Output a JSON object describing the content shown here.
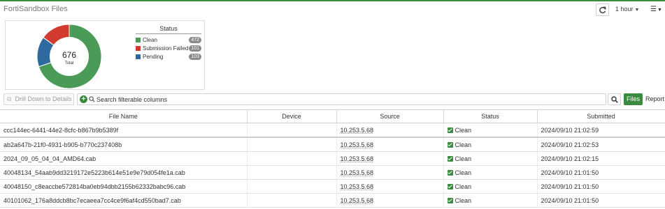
{
  "header": {
    "title": "FortiSandbox Files",
    "time_range": "1 hour",
    "refresh_icon": "refresh-icon",
    "menu_icon": "hamburger-menu-icon"
  },
  "chart_data": {
    "type": "pie",
    "center_value": "676",
    "center_label": "Total",
    "legend_title": "Status",
    "categories": [
      "Clean",
      "Submission Failed",
      "Pending"
    ],
    "values": [
      472,
      101,
      103
    ],
    "colors": [
      "#4a9a58",
      "#d23a30",
      "#2e6aa0"
    ]
  },
  "toolbar": {
    "drill_down_label": "Drill Down to Details",
    "search_placeholder": "Search filterable columns",
    "files_tab": "Files",
    "report_tab": "Report"
  },
  "table": {
    "columns": [
      "File Name",
      "Device",
      "Source",
      "Status",
      "Submitted"
    ],
    "rows": [
      {
        "file": "ccc144ec-6441-44e2-8cfc-b867b9b5389f",
        "device": "",
        "source": "10.253.5.68",
        "status": "Clean",
        "submitted": "2024/09/10 21:02:59"
      },
      {
        "file": "ab2a647b-21f0-4931-b905-b770c237408b",
        "device": "",
        "source": "10.253.5.68",
        "status": "Clean",
        "submitted": "2024/09/10 21:02:53"
      },
      {
        "file": "2024_09_05_04_04_AMD64.cab",
        "device": "",
        "source": "10.253.5.68",
        "status": "Clean",
        "submitted": "2024/09/10 21:02:15"
      },
      {
        "file": "40048134_54aab9dd3219172e5223b614e51e9e79d054fe1a.cab",
        "device": "",
        "source": "10.253.5.68",
        "status": "Clean",
        "submitted": "2024/09/10 21:01:50"
      },
      {
        "file": "40048150_c8eaccbe572814ba0eb94dbb2155b62332babc96.cab",
        "device": "",
        "source": "10.253.5.68",
        "status": "Clean",
        "submitted": "2024/09/10 21:01:50"
      },
      {
        "file": "40101062_176a8ddcb8bc7ecaeea7cc4ce9f6af4cd550bad7.cab",
        "device": "",
        "source": "10.253.5.68",
        "status": "Clean",
        "submitted": "2024/09/10 21:01:50"
      }
    ]
  }
}
